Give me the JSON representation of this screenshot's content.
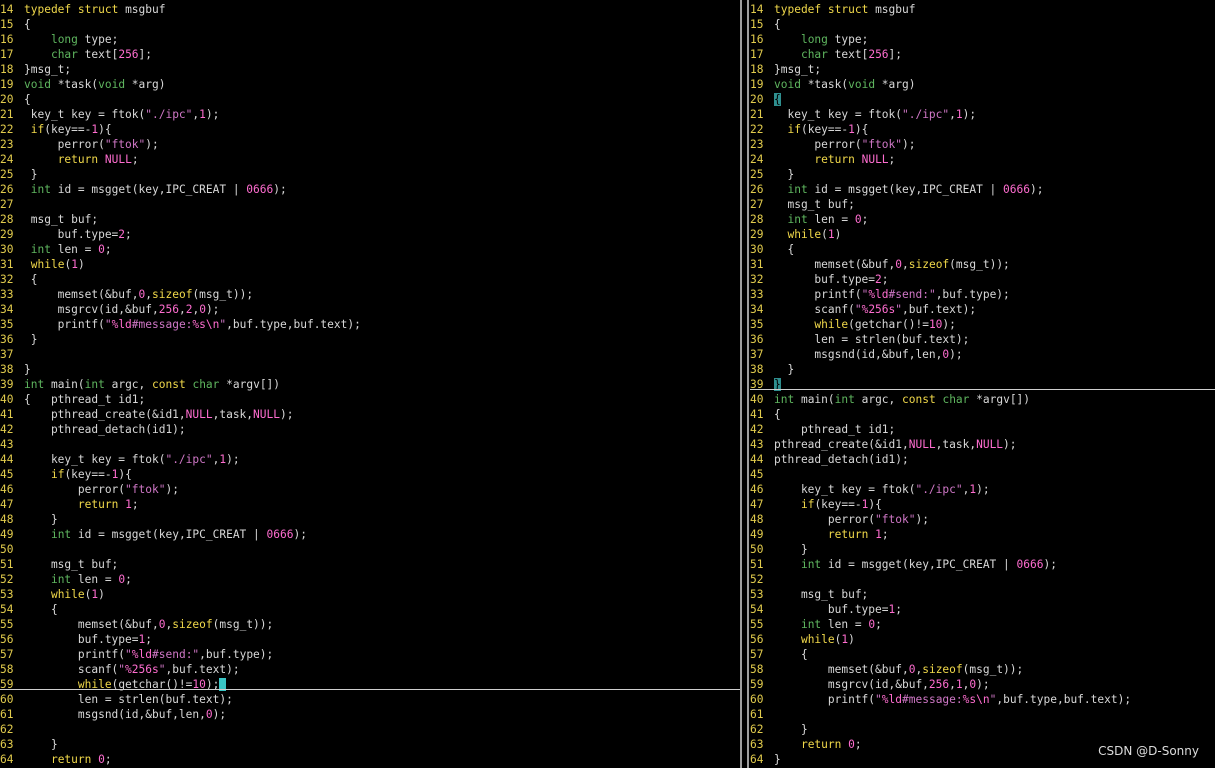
{
  "left_pane": {
    "lines": [
      {
        "n": "14",
        "t": "typedef struct msgbuf"
      },
      {
        "n": "15",
        "t": "{"
      },
      {
        "n": "16",
        "t": "    long type;"
      },
      {
        "n": "17",
        "t": "    char text[256];"
      },
      {
        "n": "18",
        "t": "}msg_t;"
      },
      {
        "n": "19",
        "t": "void *task(void *arg)"
      },
      {
        "n": "20",
        "t": "{"
      },
      {
        "n": "21",
        "t": " key_t key = ftok(\"./ipc\",1);"
      },
      {
        "n": "22",
        "t": " if(key==-1){"
      },
      {
        "n": "23",
        "t": "     perror(\"ftok\");"
      },
      {
        "n": "24",
        "t": "     return NULL;"
      },
      {
        "n": "25",
        "t": " }"
      },
      {
        "n": "26",
        "t": " int id = msgget(key,IPC_CREAT | 0666);"
      },
      {
        "n": "27",
        "t": ""
      },
      {
        "n": "28",
        "t": " msg_t buf;"
      },
      {
        "n": "29",
        "t": "     buf.type=2;"
      },
      {
        "n": "30",
        "t": " int len = 0;"
      },
      {
        "n": "31",
        "t": " while(1)"
      },
      {
        "n": "32",
        "t": " {"
      },
      {
        "n": "33",
        "t": "     memset(&buf,0,sizeof(msg_t));"
      },
      {
        "n": "34",
        "t": "     msgrcv(id,&buf,256,2,0);"
      },
      {
        "n": "35",
        "t": "     printf(\"%ld#message:%s\\n\",buf.type,buf.text);"
      },
      {
        "n": "36",
        "t": " }"
      },
      {
        "n": "37",
        "t": ""
      },
      {
        "n": "38",
        "t": "}"
      },
      {
        "n": "39",
        "t": "int main(int argc, const char *argv[])"
      },
      {
        "n": "40",
        "t": "{   pthread_t id1;"
      },
      {
        "n": "41",
        "t": "    pthread_create(&id1,NULL,task,NULL);"
      },
      {
        "n": "42",
        "t": "    pthread_detach(id1);"
      },
      {
        "n": "43",
        "t": ""
      },
      {
        "n": "44",
        "t": "    key_t key = ftok(\"./ipc\",1);"
      },
      {
        "n": "45",
        "t": "    if(key==-1){"
      },
      {
        "n": "46",
        "t": "        perror(\"ftok\");"
      },
      {
        "n": "47",
        "t": "        return 1;"
      },
      {
        "n": "48",
        "t": "    }"
      },
      {
        "n": "49",
        "t": "    int id = msgget(key,IPC_CREAT | 0666);"
      },
      {
        "n": "50",
        "t": ""
      },
      {
        "n": "51",
        "t": "    msg_t buf;"
      },
      {
        "n": "52",
        "t": "    int len = 0;"
      },
      {
        "n": "53",
        "t": "    while(1)"
      },
      {
        "n": "54",
        "t": "    {"
      },
      {
        "n": "55",
        "t": "        memset(&buf,0,sizeof(msg_t));"
      },
      {
        "n": "56",
        "t": "        buf.type=1;"
      },
      {
        "n": "57",
        "t": "        printf(\"%ld#send:\",buf.type);"
      },
      {
        "n": "58",
        "t": "        scanf(\"%256s\",buf.text);"
      },
      {
        "n": "59",
        "t": "        while(getchar()!=10);"
      },
      {
        "n": "60",
        "t": "        len = strlen(buf.text);"
      },
      {
        "n": "61",
        "t": "        msgsnd(id,&buf,len,0);"
      },
      {
        "n": "62",
        "t": ""
      },
      {
        "n": "63",
        "t": "    }"
      },
      {
        "n": "64",
        "t": "    return 0;"
      }
    ]
  },
  "right_pane": {
    "lines": [
      {
        "n": "14",
        "t": "typedef struct msgbuf"
      },
      {
        "n": "15",
        "t": "{"
      },
      {
        "n": "16",
        "t": "    long type;"
      },
      {
        "n": "17",
        "t": "    char text[256];"
      },
      {
        "n": "18",
        "t": "}msg_t;"
      },
      {
        "n": "19",
        "t": "void *task(void *arg)"
      },
      {
        "n": "20",
        "t": "{"
      },
      {
        "n": "21",
        "t": "  key_t key = ftok(\"./ipc\",1);"
      },
      {
        "n": "22",
        "t": "  if(key==-1){"
      },
      {
        "n": "23",
        "t": "      perror(\"ftok\");"
      },
      {
        "n": "24",
        "t": "      return NULL;"
      },
      {
        "n": "25",
        "t": "  }"
      },
      {
        "n": "26",
        "t": "  int id = msgget(key,IPC_CREAT | 0666);"
      },
      {
        "n": "27",
        "t": "  msg_t buf;"
      },
      {
        "n": "28",
        "t": "  int len = 0;"
      },
      {
        "n": "29",
        "t": "  while(1)"
      },
      {
        "n": "30",
        "t": "  {"
      },
      {
        "n": "31",
        "t": "      memset(&buf,0,sizeof(msg_t));"
      },
      {
        "n": "32",
        "t": "      buf.type=2;"
      },
      {
        "n": "33",
        "t": "      printf(\"%ld#send:\",buf.type);"
      },
      {
        "n": "34",
        "t": "      scanf(\"%256s\",buf.text);"
      },
      {
        "n": "35",
        "t": "      while(getchar()!=10);"
      },
      {
        "n": "36",
        "t": "      len = strlen(buf.text);"
      },
      {
        "n": "37",
        "t": "      msgsnd(id,&buf,len,0);"
      },
      {
        "n": "38",
        "t": "  }"
      },
      {
        "n": "39",
        "t": "}"
      },
      {
        "n": "40",
        "t": "int main(int argc, const char *argv[])"
      },
      {
        "n": "41",
        "t": "{"
      },
      {
        "n": "42",
        "t": "    pthread_t id1;"
      },
      {
        "n": "43",
        "t": "pthread_create(&id1,NULL,task,NULL);"
      },
      {
        "n": "44",
        "t": "pthread_detach(id1);"
      },
      {
        "n": "45",
        "t": ""
      },
      {
        "n": "46",
        "t": "    key_t key = ftok(\"./ipc\",1);"
      },
      {
        "n": "47",
        "t": "    if(key==-1){"
      },
      {
        "n": "48",
        "t": "        perror(\"ftok\");"
      },
      {
        "n": "49",
        "t": "        return 1;"
      },
      {
        "n": "50",
        "t": "    }"
      },
      {
        "n": "51",
        "t": "    int id = msgget(key,IPC_CREAT | 0666);"
      },
      {
        "n": "52",
        "t": ""
      },
      {
        "n": "53",
        "t": "    msg_t buf;"
      },
      {
        "n": "54",
        "t": "        buf.type=1;"
      },
      {
        "n": "55",
        "t": "    int len = 0;"
      },
      {
        "n": "56",
        "t": "    while(1)"
      },
      {
        "n": "57",
        "t": "    {"
      },
      {
        "n": "58",
        "t": "        memset(&buf,0,sizeof(msg_t));"
      },
      {
        "n": "59",
        "t": "        msgrcv(id,&buf,256,1,0);"
      },
      {
        "n": "60",
        "t": "        printf(\"%ld#message:%s\\n\",buf.type,buf.text);"
      },
      {
        "n": "61",
        "t": ""
      },
      {
        "n": "62",
        "t": "    }"
      },
      {
        "n": "63",
        "t": "    return 0;"
      },
      {
        "n": "64",
        "t": "}"
      }
    ]
  },
  "watermark": "CSDN @D-Sonny",
  "colors": {
    "background": "#000000",
    "line_number": "#e2cc4d",
    "keyword": "#f0d84a",
    "type": "#5fb65f",
    "number": "#ff6dd0",
    "string": "#cf77c6",
    "default_text": "#d8d8d8",
    "cursor": "#39c5c5",
    "bracket_match": "#2f8f8f"
  },
  "icons": {
    "cursor": "block-cursor-icon"
  }
}
